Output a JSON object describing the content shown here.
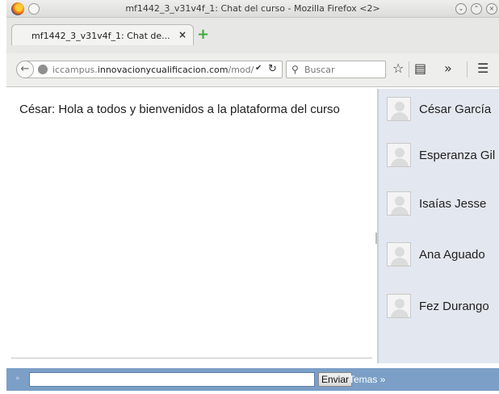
{
  "window": {
    "title": "mf1442_3_v31v4f_1: Chat del curso - Mozilla Firefox <2>"
  },
  "tab": {
    "label": "mf1442_3_v31v4f_1: Chat de...",
    "close_glyph": "×",
    "new_tab_glyph": "+"
  },
  "navbar": {
    "url_prefix": "iccampus.",
    "url_domain": "innovacionycualificacion.com",
    "url_path": "/mod/",
    "search_placeholder": "Buscar"
  },
  "chat": {
    "messages": [
      {
        "author": "César",
        "text": "César: Hola a todos y bienvenidos a la plataforma del curso"
      }
    ]
  },
  "users": [
    {
      "name": "César García"
    },
    {
      "name": "Esperanza Gil"
    },
    {
      "name": "Isaías Jesse"
    },
    {
      "name": "Ana Aguado"
    },
    {
      "name": "Fez Durango"
    }
  ],
  "input": {
    "prompt": "»",
    "value": "",
    "send_label": "Enviar",
    "themes_label": "Temas »"
  },
  "colors": {
    "users_panel": "#e3e7ef",
    "input_bar": "#7b9fc6"
  },
  "icons": [
    "firefox-logo-icon",
    "back-arrow-icon",
    "globe-icon",
    "dropmarker-icon",
    "reload-icon",
    "search-icon",
    "bookmark-star-icon",
    "clipboard-icon",
    "overflow-chevron-icon",
    "hamburger-menu-icon",
    "avatar-icon"
  ]
}
